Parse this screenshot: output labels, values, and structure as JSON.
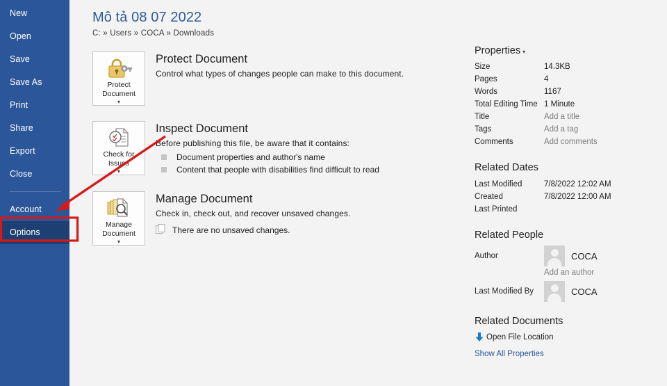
{
  "sidebar": {
    "items": [
      {
        "label": "New",
        "selected": false
      },
      {
        "label": "Open",
        "selected": false
      },
      {
        "label": "Save",
        "selected": false
      },
      {
        "label": "Save As",
        "selected": false
      },
      {
        "label": "Print",
        "selected": false
      },
      {
        "label": "Share",
        "selected": false
      },
      {
        "label": "Export",
        "selected": false
      },
      {
        "label": "Close",
        "selected": false
      },
      {
        "label": "Account",
        "selected": false
      },
      {
        "label": "Options",
        "selected": true
      }
    ]
  },
  "header": {
    "title": "Mô tả 08 07 2022",
    "breadcrumb": "C: » Users » COCA » Downloads"
  },
  "sections": {
    "protect": {
      "button_label": "Protect\nDocument",
      "button_caret": "▾",
      "icon": "padlock-key-icon",
      "heading": "Protect Document",
      "description": "Control what types of changes people can make to this document."
    },
    "inspect": {
      "button_label": "Check for\nIssues",
      "button_caret": "▾",
      "icon": "document-inspect-icon",
      "heading": "Inspect Document",
      "description": "Before publishing this file, be aware that it contains:",
      "bullets": [
        "Document properties and author's name",
        "Content that people with disabilities find difficult to read"
      ]
    },
    "manage": {
      "button_label": "Manage\nDocument",
      "button_caret": "▾",
      "icon": "document-stack-search-icon",
      "heading": "Manage Document",
      "description": "Check in, check out, and recover unsaved changes.",
      "status": "There are no unsaved changes."
    }
  },
  "properties": {
    "heading": "Properties",
    "caret": "▾",
    "rows": [
      {
        "key": "Size",
        "value": "14.3KB",
        "placeholder": false
      },
      {
        "key": "Pages",
        "value": "4",
        "placeholder": false
      },
      {
        "key": "Words",
        "value": "1167",
        "placeholder": false
      },
      {
        "key": "Total Editing Time",
        "value": "1 Minute",
        "placeholder": false
      },
      {
        "key": "Title",
        "value": "Add a title",
        "placeholder": true
      },
      {
        "key": "Tags",
        "value": "Add a tag",
        "placeholder": true
      },
      {
        "key": "Comments",
        "value": "Add comments",
        "placeholder": true
      }
    ]
  },
  "related_dates": {
    "heading": "Related Dates",
    "rows": [
      {
        "key": "Last Modified",
        "value": "7/8/2022 12:02 AM"
      },
      {
        "key": "Created",
        "value": "7/8/2022 12:00 AM"
      },
      {
        "key": "Last Printed",
        "value": ""
      }
    ]
  },
  "related_people": {
    "heading": "Related People",
    "author_key": "Author",
    "author_name": "COCA",
    "add_author": "Add an author",
    "modified_by_key": "Last Modified By",
    "modified_by_name": "COCA"
  },
  "related_documents": {
    "heading": "Related Documents",
    "open_location": "Open File Location",
    "show_all": "Show All Properties"
  },
  "annotation": {
    "color": "#d61a1a",
    "arrow_name": "red-arrow-pointing-to-options",
    "box_name": "red-highlight-box-options"
  },
  "colors": {
    "sidebar_blue": "#2b579a",
    "sidebar_selected": "#1e3f72",
    "title_blue": "#2e5b9e",
    "background": "#f3f3f3",
    "link_blue": "#2b579a",
    "annotation_red": "#d61a1a"
  }
}
